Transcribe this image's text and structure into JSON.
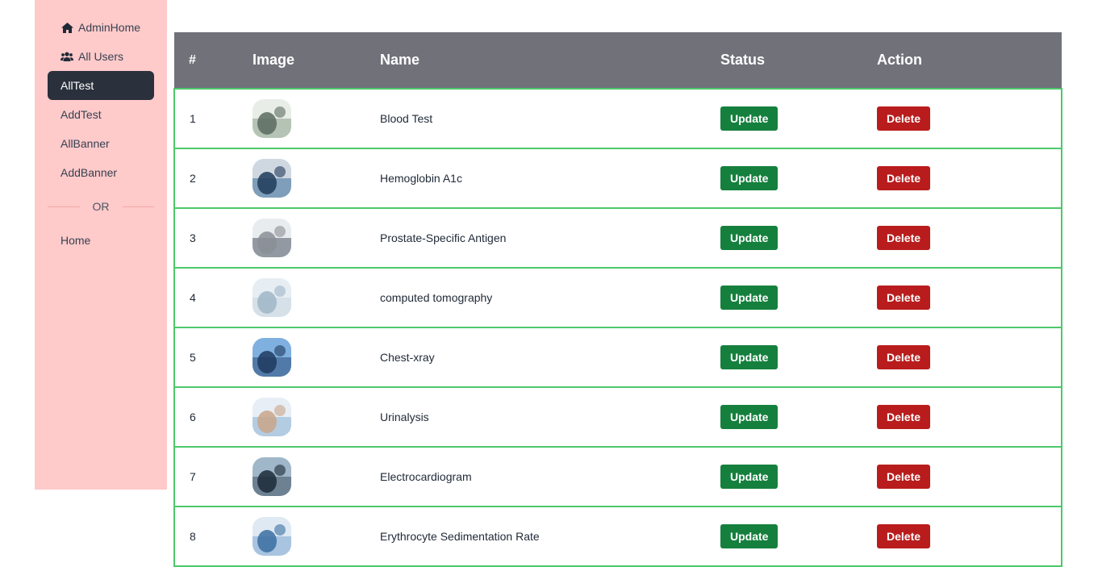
{
  "sidebar": {
    "items": [
      {
        "label": "AdminHome",
        "icon": "home-icon",
        "active": false
      },
      {
        "label": "All Users",
        "icon": "users-icon",
        "active": false
      },
      {
        "label": "AllTest",
        "icon": "",
        "active": true
      },
      {
        "label": "AddTest",
        "icon": "",
        "active": false
      },
      {
        "label": "AllBanner",
        "icon": "",
        "active": false
      },
      {
        "label": "AddBanner",
        "icon": "",
        "active": false
      }
    ],
    "divider_text": "OR",
    "bottom_items": [
      {
        "label": "Home"
      }
    ]
  },
  "table": {
    "headers": [
      "#",
      "Image",
      "Name",
      "Status",
      "Action"
    ],
    "rows": [
      {
        "num": "1",
        "name": "Blood Test",
        "status_button": "Update",
        "action_button": "Delete",
        "thumb_colors": [
          "#5b6b5f",
          "#e8ede7",
          "#8aa08d"
        ]
      },
      {
        "num": "2",
        "name": "Hemoglobin A1c",
        "status_button": "Update",
        "action_button": "Delete",
        "thumb_colors": [
          "#1f3b5a",
          "#cfd8e0",
          "#3c6f9a"
        ]
      },
      {
        "num": "3",
        "name": "Prostate-Specific Antigen",
        "status_button": "Update",
        "action_button": "Delete",
        "thumb_colors": [
          "#8a8f95",
          "#e9ecef",
          "#4b5563"
        ]
      },
      {
        "num": "4",
        "name": "computed tomography",
        "status_button": "Update",
        "action_button": "Delete",
        "thumb_colors": [
          "#9fb6c6",
          "#e6eef3",
          "#c7d6e0"
        ]
      },
      {
        "num": "5",
        "name": "Chest-xray",
        "status_button": "Update",
        "action_button": "Delete",
        "thumb_colors": [
          "#1e3a5f",
          "#7fb0e0",
          "#2b4f7a"
        ]
      },
      {
        "num": "6",
        "name": "Urinalysis",
        "status_button": "Update",
        "action_button": "Delete",
        "thumb_colors": [
          "#c9a58a",
          "#e7eef5",
          "#8ab0d0"
        ]
      },
      {
        "num": "7",
        "name": "Electrocardiogram",
        "status_button": "Update",
        "action_button": "Delete",
        "thumb_colors": [
          "#1c2a38",
          "#9fb7c9",
          "#445566"
        ]
      },
      {
        "num": "8",
        "name": "Erythrocyte Sedimentation Rate",
        "status_button": "Update",
        "action_button": "Delete",
        "thumb_colors": [
          "#3b6fa0",
          "#dfe9f3",
          "#7aa6cf"
        ]
      }
    ]
  },
  "colors": {
    "sidebar_bg": "#fecaca",
    "active_bg": "#2a303c",
    "header_bg": "#71717a",
    "row_border": "#4cc86a",
    "update_btn": "#15803d",
    "delete_btn": "#b91c1c"
  }
}
